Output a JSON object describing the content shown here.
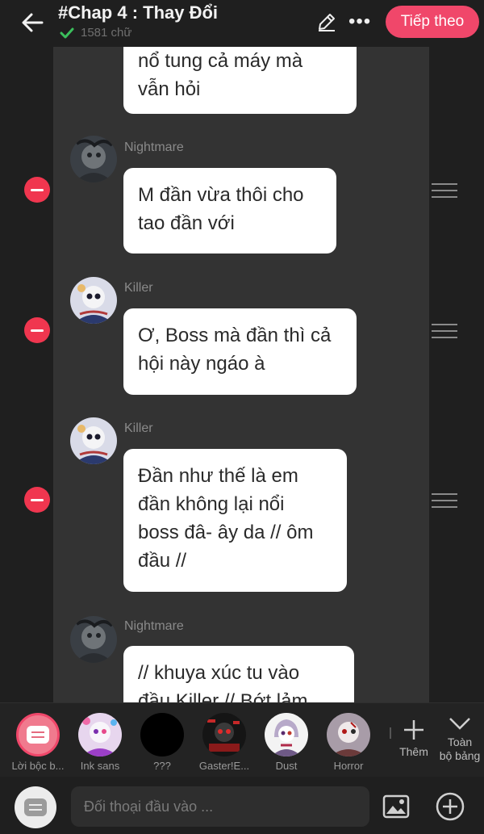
{
  "header": {
    "title": "#Chap 4 : Thay Đổi",
    "word_count": "1581 chữ",
    "next_label": "Tiếp theo",
    "more_label": "•••"
  },
  "messages": [
    {
      "speaker": "",
      "lines": [
        "nổ tung cả máy mà",
        "vẫn hỏi"
      ]
    },
    {
      "speaker": "Nightmare",
      "lines": [
        "M đần vừa thôi cho",
        "tao đần với"
      ]
    },
    {
      "speaker": "Killer",
      "lines": [
        "Ơ, Boss mà đần thì cả",
        "hội này ngáo à"
      ]
    },
    {
      "speaker": "Killer",
      "lines": [
        "Đần như thế là em",
        "đần không lại nổi",
        "boss đâ- ây da // ôm",
        "đầu //"
      ]
    },
    {
      "speaker": "Nightmare",
      "lines": [
        "// khuya xúc tu vào",
        "đầu Killer // Bớt lảm"
      ]
    }
  ],
  "characters": [
    {
      "label": "Lời bộc b...",
      "icon": "narrator-icon"
    },
    {
      "label": "Ink sans",
      "icon": "avatar"
    },
    {
      "label": "???",
      "icon": "avatar"
    },
    {
      "label": "Gaster!E...",
      "icon": "avatar"
    },
    {
      "label": "Dust",
      "icon": "avatar"
    },
    {
      "label": "Horror",
      "icon": "avatar"
    }
  ],
  "tools": {
    "add_label": "Thêm",
    "all_label_1": "Toàn",
    "all_label_2": "bộ bảng"
  },
  "input": {
    "placeholder": "Đối thoại đầu vào ..."
  },
  "colors": {
    "accent": "#f0476a",
    "remove": "#f0364f",
    "background": "#1f1f1f",
    "chat_column": "#333333",
    "bubble": "#ffffff"
  }
}
